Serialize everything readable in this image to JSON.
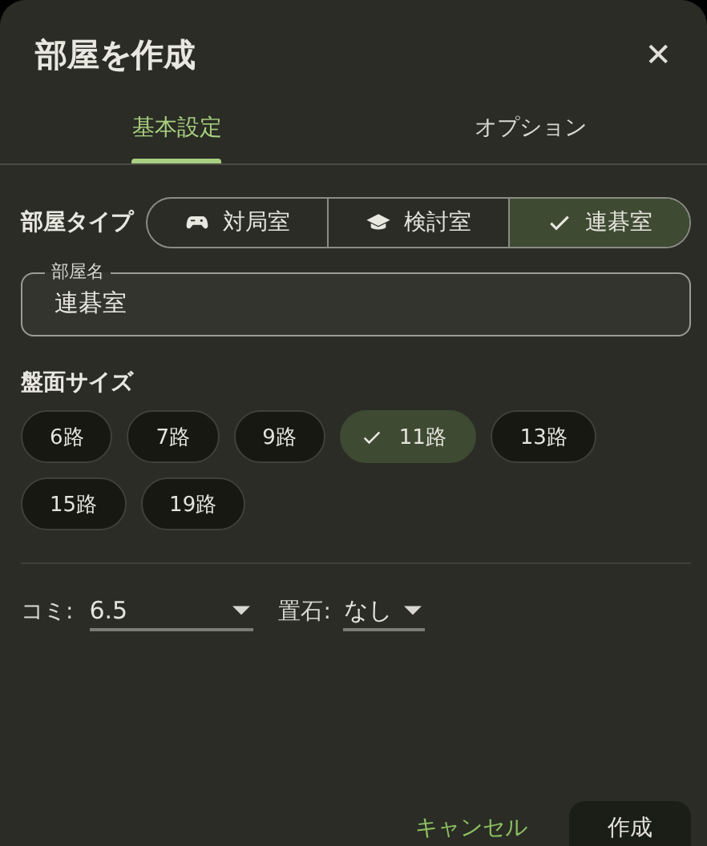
{
  "dialog": {
    "title": "部屋を作成",
    "close": "✕"
  },
  "tabs": [
    {
      "label": "基本設定",
      "selected": true
    },
    {
      "label": "オプション",
      "selected": false
    }
  ],
  "room_type": {
    "label": "部屋タイプ",
    "options": [
      {
        "label": "対局室",
        "selected": false
      },
      {
        "label": "検討室",
        "selected": false
      },
      {
        "label": "連碁室",
        "selected": true
      }
    ]
  },
  "room_name": {
    "label": "部屋名",
    "value": "連碁室"
  },
  "board_size": {
    "label": "盤面サイズ",
    "options": [
      {
        "label": "6路",
        "selected": false
      },
      {
        "label": "7路",
        "selected": false
      },
      {
        "label": "9路",
        "selected": false
      },
      {
        "label": "11路",
        "selected": true
      },
      {
        "label": "13路",
        "selected": false
      },
      {
        "label": "15路",
        "selected": false
      },
      {
        "label": "19路",
        "selected": false
      }
    ]
  },
  "komi": {
    "label": "コミ:",
    "value": "6.5"
  },
  "handicap": {
    "label": "置石:",
    "value": "なし"
  },
  "buttons": {
    "cancel": "キャンセル",
    "create": "作成"
  }
}
